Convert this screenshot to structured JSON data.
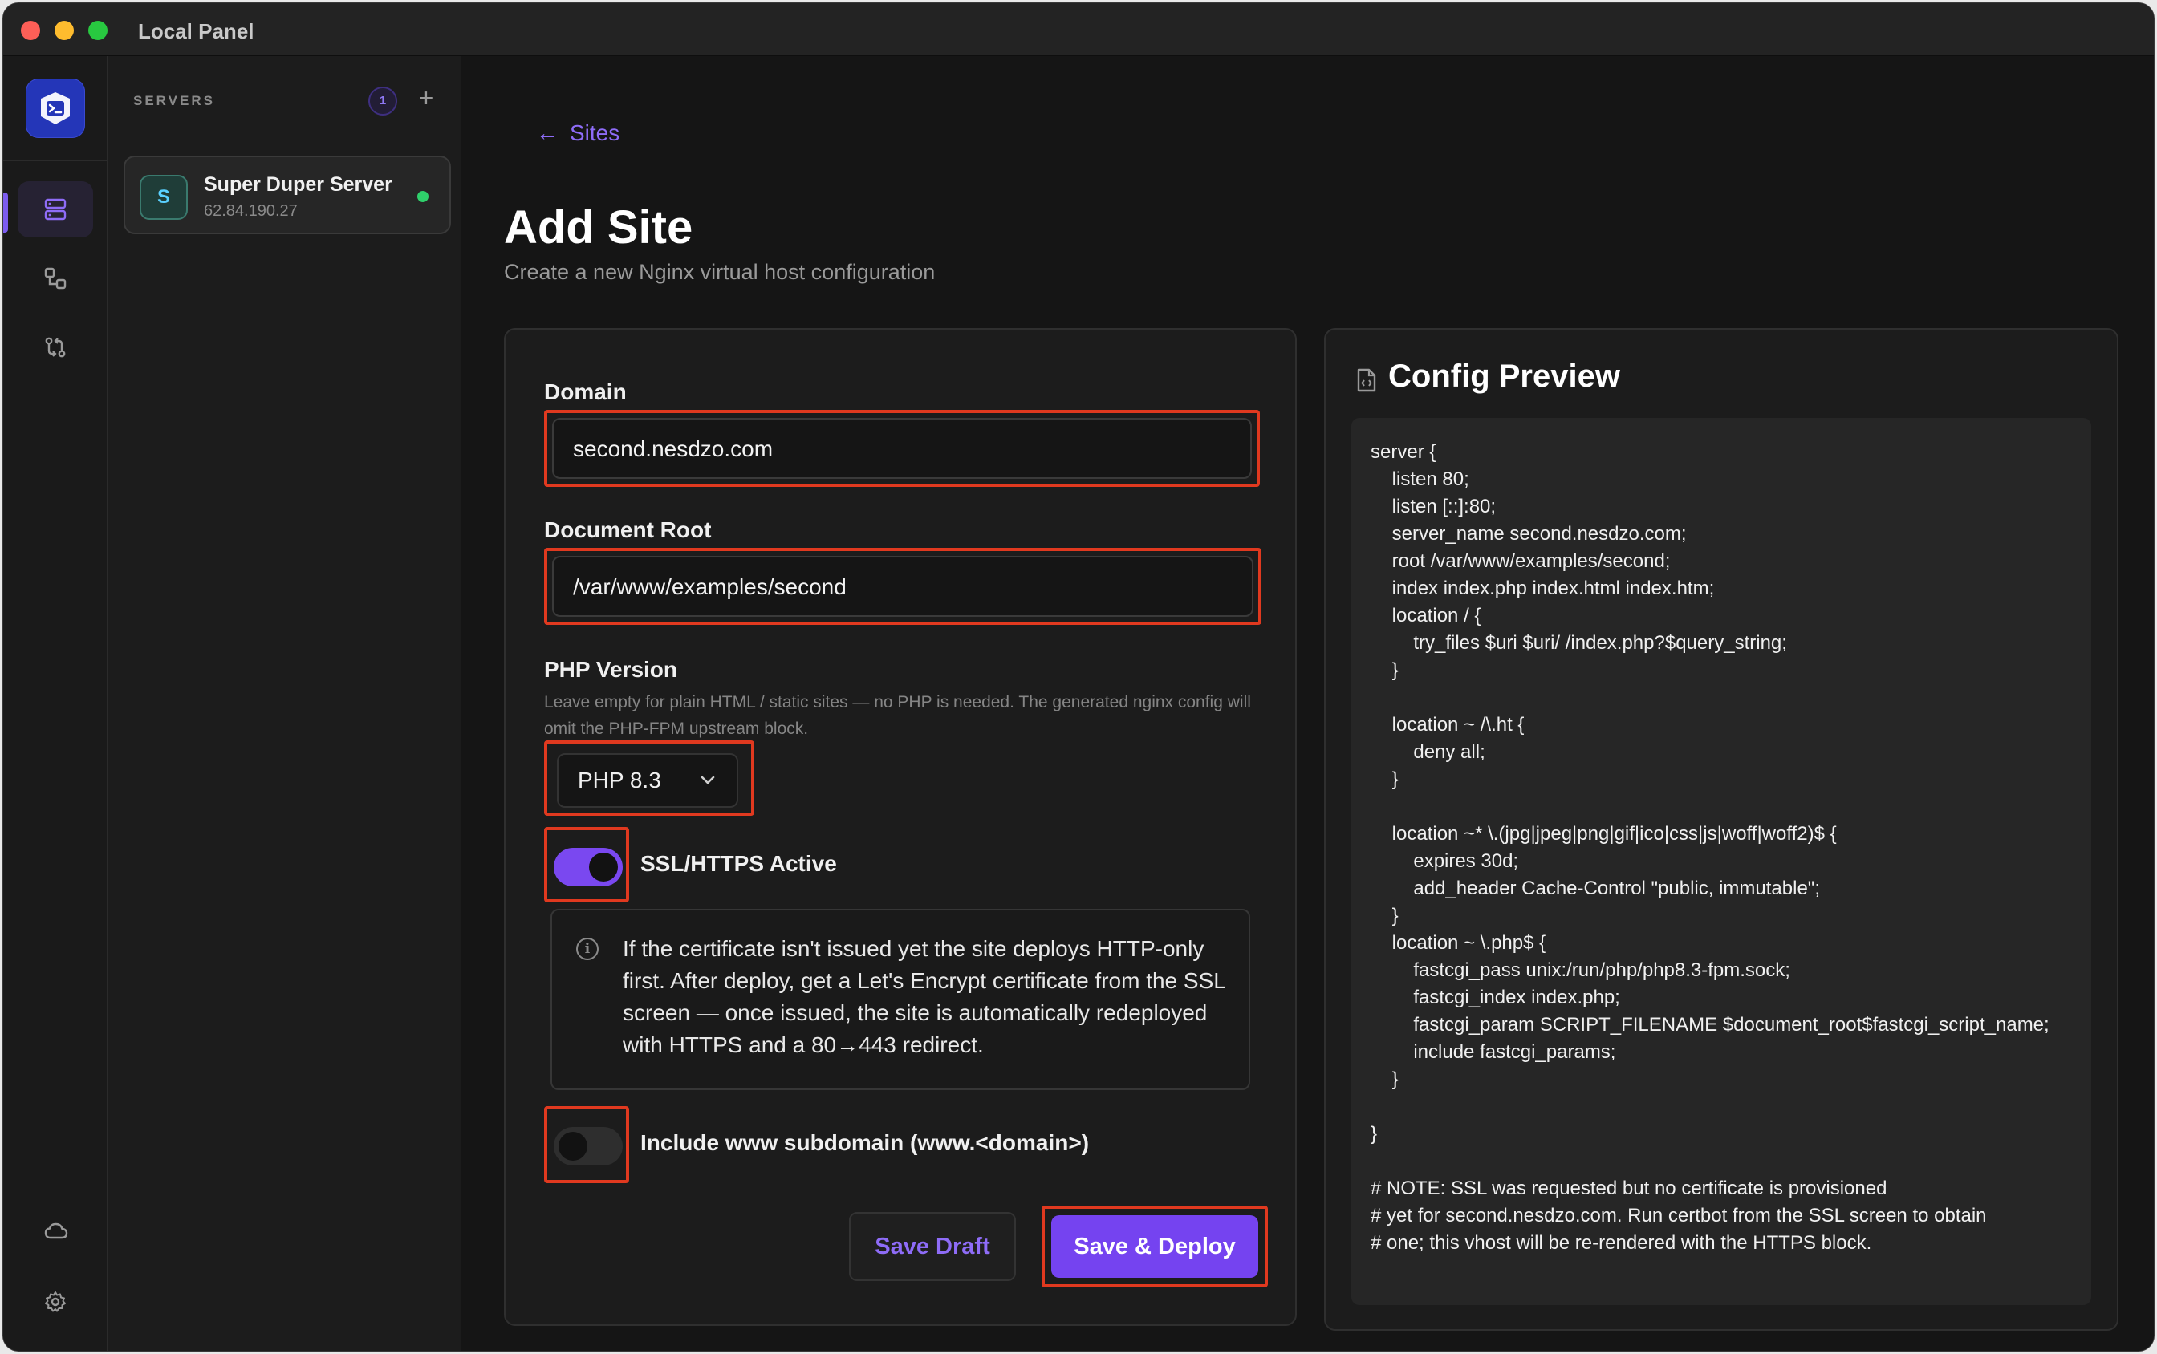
{
  "window": {
    "title": "Local Panel"
  },
  "servers": {
    "header": "SERVERS",
    "count": "1",
    "add_label": "+",
    "items": [
      {
        "initial": "S",
        "name": "Super Duper Server",
        "ip": "62.84.190.27",
        "status_color": "#2fd06b"
      }
    ]
  },
  "main": {
    "back_label": "Sites",
    "title": "Add Site",
    "subtitle": "Create a new Nginx virtual host configuration"
  },
  "form": {
    "domain_label": "Domain",
    "domain_value": "second.nesdzo.com",
    "docroot_label": "Document Root",
    "docroot_value": "/var/www/examples/second",
    "php_label": "PHP Version",
    "php_help": "Leave empty for plain HTML / static sites — no PHP is needed. The generated nginx config will omit the PHP-FPM upstream block.",
    "php_selected": "PHP 8.3",
    "ssl_label": "SSL/HTTPS Active",
    "ssl_on": true,
    "ssl_info": "If the certificate isn't issued yet the site deploys HTTP-only first. After deploy, get a Let's Encrypt certificate from the SSL screen — once issued, the site is automatically redeployed with HTTPS and a 80→443 redirect.",
    "www_label": "Include www subdomain (www.<domain>)",
    "www_on": false,
    "save_draft_label": "Save Draft",
    "save_deploy_label": "Save & Deploy"
  },
  "preview": {
    "title": "Config Preview",
    "lines": [
      "server {",
      "    listen 80;",
      "    listen [::]:80;",
      "    server_name second.nesdzo.com;",
      "    root /var/www/examples/second;",
      "    index index.php index.html index.htm;",
      "    location / {",
      "        try_files $uri $uri/ /index.php?$query_string;",
      "    }",
      "",
      "    location ~ /\\.ht {",
      "        deny all;",
      "    }",
      "",
      "    location ~* \\.(jpg|jpeg|png|gif|ico|css|js|woff|woff2)$ {",
      "        expires 30d;",
      "        add_header Cache-Control \"public, immutable\";",
      "    }",
      "    location ~ \\.php$ {",
      "        fastcgi_pass unix:/run/php/php8.3-fpm.sock;",
      "        fastcgi_index index.php;",
      "        fastcgi_param SCRIPT_FILENAME $document_root$fastcgi_script_name;",
      "        include fastcgi_params;",
      "    }",
      "",
      "}",
      "",
      "# NOTE: SSL was requested but no certificate is provisioned",
      "# yet for second.nesdzo.com. Run certbot from the SSL screen to obtain",
      "# one; this vhost will be re-rendered with the HTTPS block."
    ]
  },
  "colors": {
    "accent": "#7543f0",
    "highlight": "#e0391f",
    "status_online": "#2fd06b"
  },
  "icons": {
    "rail": [
      "servers-icon",
      "connections-icon",
      "git-compare-icon",
      "cloud-icon",
      "settings-icon"
    ]
  }
}
